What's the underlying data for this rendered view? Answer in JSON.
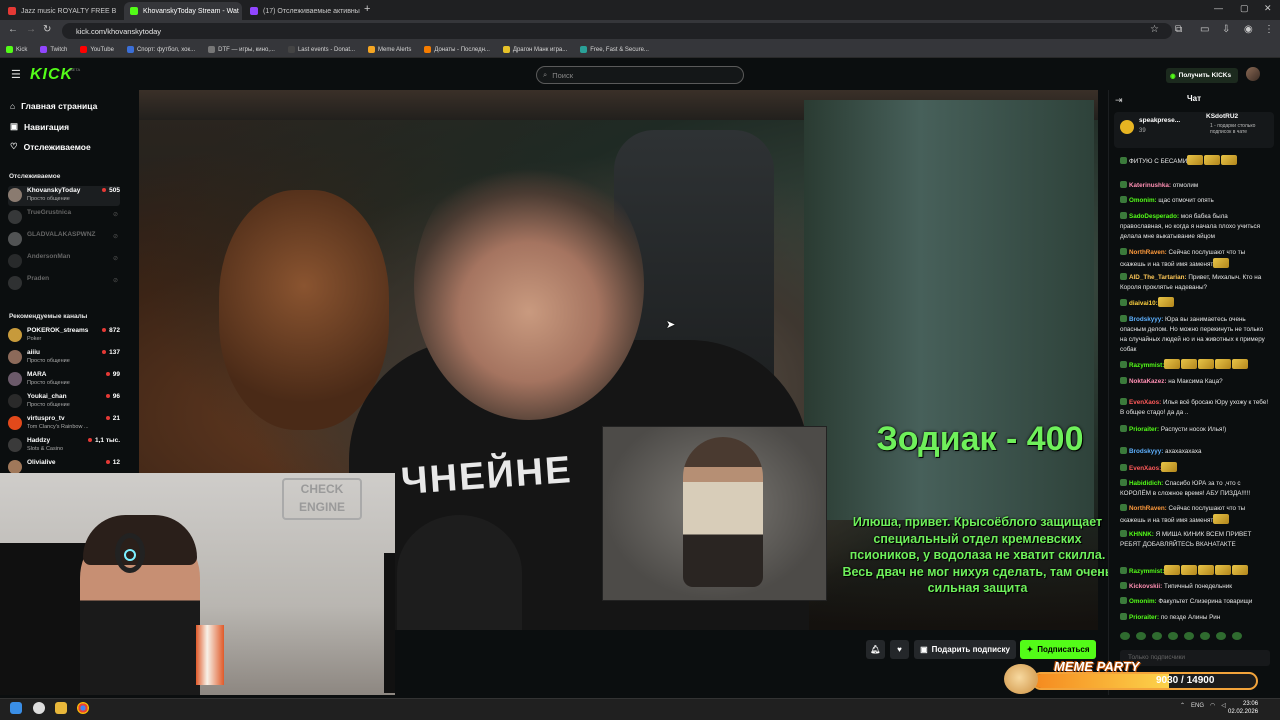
{
  "browser": {
    "tabs": [
      {
        "label": "Jazz music ROYALTY FREE B",
        "color": "#e53935"
      },
      {
        "label": "KhovanskyToday Stream - Wat",
        "color": "#53fc18"
      },
      {
        "label": "(17) Отслеживаемые активны",
        "color": "#9146ff"
      }
    ],
    "url": "kick.com/khovanskytoday",
    "bookmarks": [
      {
        "label": "Kick",
        "color": "#53fc18"
      },
      {
        "label": "Twitch",
        "color": "#9146ff"
      },
      {
        "label": "YouTube",
        "color": "#ff0000"
      },
      {
        "label": "Спорт: футбол, хок...",
        "color": "#3b6fd8"
      },
      {
        "label": "DTF — игры, кино,...",
        "color": "#777777"
      },
      {
        "label": "Last events - Donat...",
        "color": "#444444"
      },
      {
        "label": "Meme Alerts",
        "color": "#f5a623"
      },
      {
        "label": "Донаты - Последн...",
        "color": "#f57c00"
      },
      {
        "label": "Драгон Манк игра...",
        "color": "#e6c229"
      },
      {
        "label": "Free, Fast & Secure...",
        "color": "#2aa198"
      }
    ]
  },
  "header": {
    "logo": "KICK",
    "logo_beta": "BETA",
    "search_placeholder": "Поиск",
    "get_kicks": "Получить KICKs"
  },
  "sidebar": {
    "nav": [
      "Главная страница",
      "Навигация",
      "Отслеживаемое"
    ],
    "following_title": "Отслеживаемое",
    "following": [
      {
        "name": "KhovanskyToday",
        "category": "Просто общение",
        "viewers": "505",
        "online": true,
        "color": "#8a7b70"
      },
      {
        "name": "TrueGrustnica",
        "category": "",
        "viewers": "",
        "online": false,
        "color": "#777777"
      },
      {
        "name": "GLADVALAKASPWNZ",
        "category": "",
        "viewers": "",
        "online": false,
        "color": "#bbbbbb"
      },
      {
        "name": "AndersonMan",
        "category": "",
        "viewers": "",
        "online": false,
        "color": "#555555"
      },
      {
        "name": "Praden",
        "category": "",
        "viewers": "",
        "online": false,
        "color": "#666666"
      }
    ],
    "recommended_title": "Рекомендуемые каналы",
    "recommended": [
      {
        "name": "POKEROK_streams",
        "category": "Poker",
        "viewers": "872",
        "color": "#c79a3b"
      },
      {
        "name": "aiiiu",
        "category": "Просто общение",
        "viewers": "137",
        "color": "#8c6a5a"
      },
      {
        "name": "MARA",
        "category": "Просто общение",
        "viewers": "99",
        "color": "#6b5a6a"
      },
      {
        "name": "Youkai_chan",
        "category": "Просто общение",
        "viewers": "96",
        "color": "#2a2a2a"
      },
      {
        "name": "virtuspro_tv",
        "category": "Tom Clancy's Rainbow ...",
        "viewers": "21",
        "color": "#e2491b"
      },
      {
        "name": "Haddzy",
        "category": "Slots & Casino",
        "viewers": "1,1 тыс.",
        "color": "#3a3a3a"
      },
      {
        "name": "Olivialive",
        "category": "",
        "viewers": "12",
        "color": "#a0785a"
      }
    ]
  },
  "stream": {
    "shirt_text": "ЧНЕЙНЕ",
    "donation_title": "Зодиак - 400",
    "donation_message": "Илюша, привет. Крысоёблого защищает специальный отдел кремлевских псиоников, у водолаза не хватит скилла. Весь двач не мог нихуя сделать, там очень сильная защита",
    "webcam_sign": "CHECK ENGINE"
  },
  "controls": {
    "gift_sub": "Подарить подписку",
    "subscribe": "Подписаться"
  },
  "chat": {
    "title": "Чат",
    "pinned": {
      "user": "speakprese...",
      "count": "39",
      "gifter": "KSdotRU2",
      "gift_text": "1 - подарки столько подписок в чате"
    },
    "messages": [
      {
        "user": "",
        "text": "ФИТУЮ С БЕСАМИ",
        "color": "#ffffff",
        "emotes": 3
      },
      {
        "user": "Katerinushka:",
        "text": " отмолим",
        "color": "#ff8fb3",
        "emotes": 0
      },
      {
        "user": "Omonim:",
        "text": " щас отмочит опять",
        "color": "#53fc18",
        "emotes": 0
      },
      {
        "user": "SadoDesperado:",
        "text": " моя бабка была православная, но когда я начала плохо учиться делала мне выкатывание яйцом",
        "color": "#53fc18",
        "emotes": 0
      },
      {
        "user": "NorthRaven:",
        "text": " Сейчас послушают что ты скажешь и на твой имя заменят",
        "color": "#ff9a3c",
        "emotes": 1
      },
      {
        "user": "AID_The_Tartarian:",
        "text": " Привет, Михалыч. Кто на Короля проклятье надеваны?",
        "color": "#ffc857",
        "emotes": 0
      },
      {
        "user": "diaivai10:",
        "text": "",
        "color": "#ffd23f",
        "emotes": 1
      },
      {
        "user": "Brodskyyy:",
        "text": " Юра вы занимаетесь очень опасным делом. Но можно перекинуть не только на случайных людей но и на животных к примеру собак",
        "color": "#5eb1ff",
        "emotes": 0
      },
      {
        "user": "Razymmist:",
        "text": "",
        "color": "#53fc18",
        "emotes": 5
      },
      {
        "user": "NoktaKazez:",
        "text": " на Максима Каца?",
        "color": "#ff8fb3",
        "emotes": 0
      },
      {
        "user": "EvenXaos:",
        "text": " Илья всё бросаю Юру ухожу к тебе! В общее стадо! да да ..",
        "color": "#ff5a5a",
        "emotes": 0
      },
      {
        "user": "Prioraiter:",
        "text": " Распусти носок Илья!)",
        "color": "#53fc18",
        "emotes": 0
      },
      {
        "user": "Brodskyyy:",
        "text": " ахахахахаха",
        "color": "#5eb1ff",
        "emotes": 0
      },
      {
        "user": "EvenXaos:",
        "text": "",
        "color": "#ff5a5a",
        "emotes": 1
      },
      {
        "user": "Habididich:",
        "text": " Спасибо ЮРА за то ,что с КОРОЛЁМ в сложное время! АБУ ПИЗДА!!!!!",
        "color": "#53fc18",
        "emotes": 0
      },
      {
        "user": "NorthRaven:",
        "text": " Сейчас послушают что ты скажешь и на твой имя заменят",
        "color": "#ff9a3c",
        "emotes": 1
      },
      {
        "user": "KHNNK:",
        "text": " Я МИША КИНИК ВСЕМ ПРИВЕТ РЕБЯТ ДОБАВЛЯЙТЕСЬ ВКАНАТАКТЕ",
        "color": "#53fc18",
        "emotes": 0
      },
      {
        "user": "Razymmist:",
        "text": "",
        "color": "#53fc18",
        "emotes": 5
      },
      {
        "user": "Kickovskii:",
        "text": " Типичный понедельник",
        "color": "#ff8fb3",
        "emotes": 0
      },
      {
        "user": "Omonim:",
        "text": " Факультет Слизерина товарищи",
        "color": "#53fc18",
        "emotes": 0
      },
      {
        "user": "Prioraiter:",
        "text": " по пезде Алины Рин",
        "color": "#53fc18",
        "emotes": 0
      }
    ],
    "input_placeholder": "Только подписчики"
  },
  "meme_party": {
    "title": "MEME PARTY",
    "count": "9030 / 14900",
    "progress": 0.606
  },
  "taskbar": {
    "lang": "ENG",
    "time": "23:06",
    "date": "02.02.2026"
  }
}
